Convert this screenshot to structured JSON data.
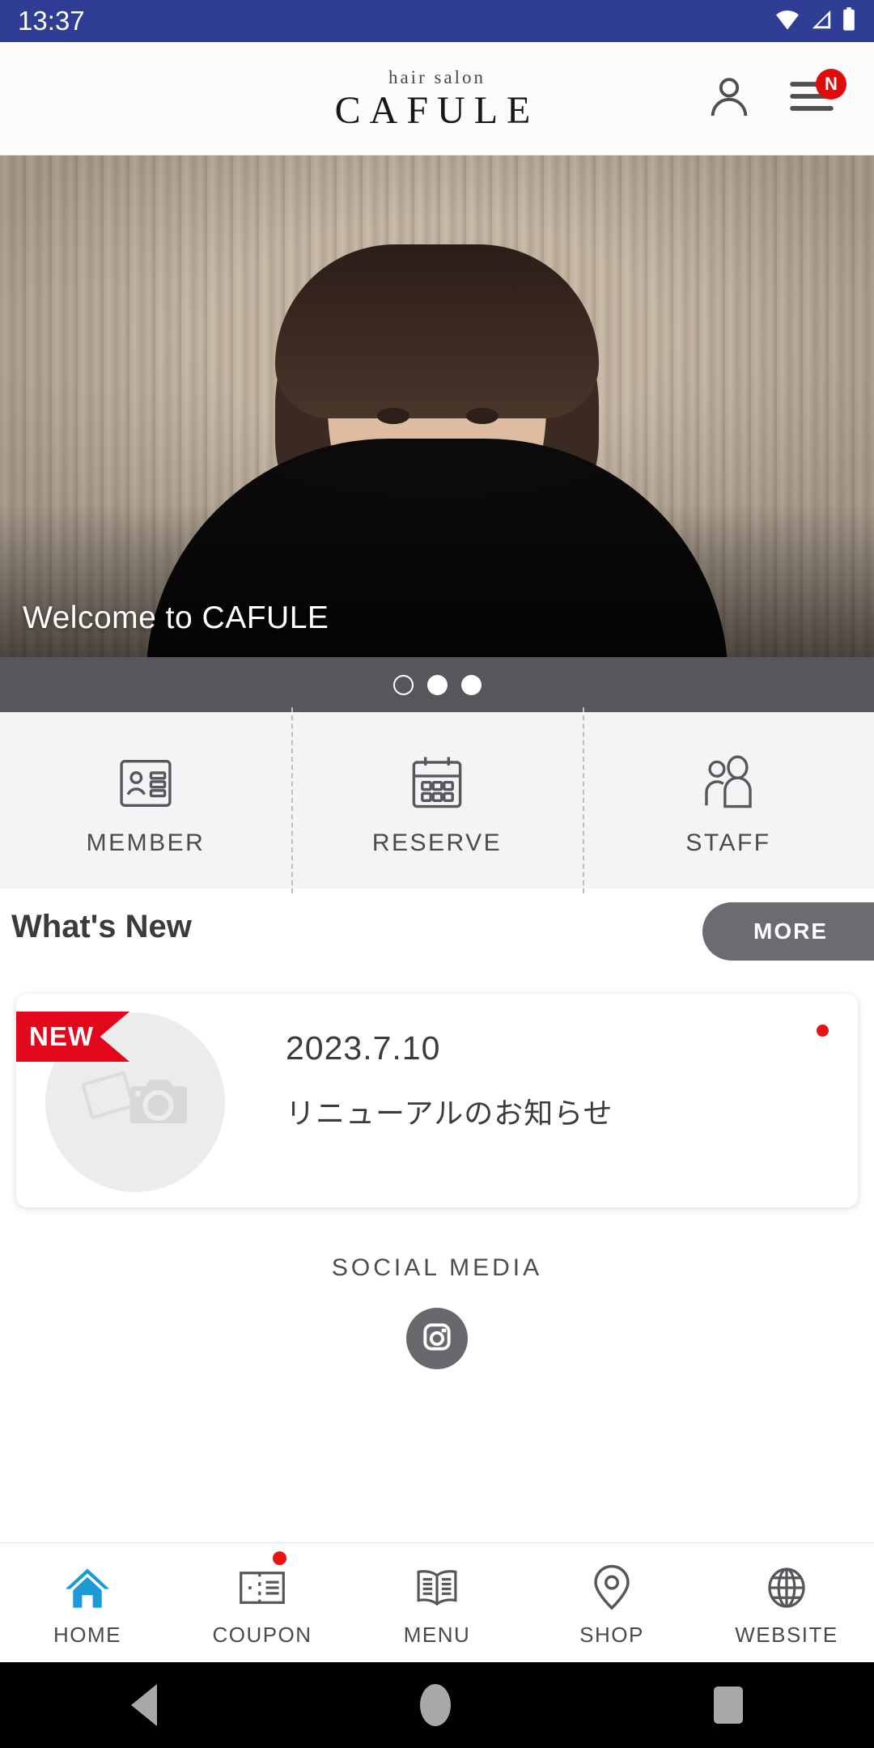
{
  "status_bar": {
    "time": "13:37",
    "icons": [
      "wifi-icon",
      "cellular-signal-icon",
      "battery-icon"
    ],
    "background_color": "#2f3d95"
  },
  "header": {
    "logo_sub": "hair salon",
    "logo_main": "CAFULE",
    "account_icon": "person-icon",
    "menu_icon": "hamburger-menu-icon",
    "menu_badge": "N",
    "badge_color": "#e00b0b"
  },
  "hero": {
    "caption": "Welcome to CAFULE",
    "carousel": {
      "total": 3,
      "current_index": 1,
      "dots": [
        "hollow",
        "filled",
        "filled"
      ]
    }
  },
  "quick_actions": [
    {
      "label": "MEMBER",
      "icon": "id-card-icon"
    },
    {
      "label": "RESERVE",
      "icon": "calendar-icon"
    },
    {
      "label": "STAFF",
      "icon": "people-icon"
    }
  ],
  "whats_new": {
    "title": "What's New",
    "more_label": "MORE",
    "more_color": "#6d6b6f",
    "items": [
      {
        "badge": "NEW",
        "badge_color": "#e2071a",
        "date": "2023.7.10",
        "title": "リニューアルのお知らせ",
        "thumbnail_icon": "photo-camera-placeholder-icon",
        "unread": true
      }
    ]
  },
  "social_media": {
    "title": "SOCIAL MEDIA",
    "accounts": [
      {
        "name": "instagram",
        "icon": "instagram-icon",
        "color": "#6a686c"
      }
    ]
  },
  "bottom_nav": {
    "active_color": "#1b9ad6",
    "items": [
      {
        "label": "HOME",
        "icon": "home-icon",
        "active": true,
        "badge": false
      },
      {
        "label": "COUPON",
        "icon": "ticket-icon",
        "active": false,
        "badge": true
      },
      {
        "label": "MENU",
        "icon": "book-icon",
        "active": false,
        "badge": false
      },
      {
        "label": "SHOP",
        "icon": "location-pin-icon",
        "active": false,
        "badge": false
      },
      {
        "label": "WEBSITE",
        "icon": "globe-icon",
        "active": false,
        "badge": false
      }
    ]
  },
  "system_nav": {
    "back": "back-triangle-icon",
    "home": "home-circle-icon",
    "recents": "recents-square-icon"
  }
}
